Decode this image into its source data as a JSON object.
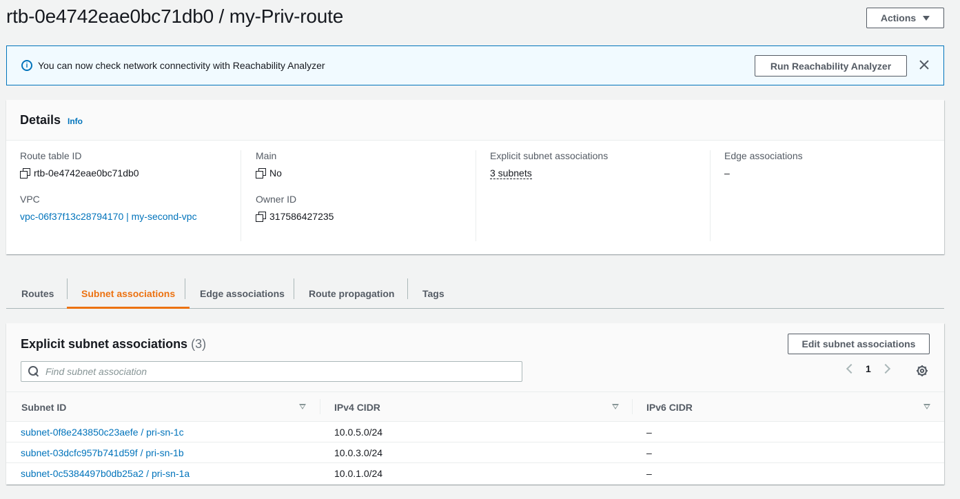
{
  "page": {
    "title": "rtb-0e4742eae0bc71db0 / my-Priv-route",
    "actions_label": "Actions"
  },
  "flash": {
    "message": "You can now check network connectivity with Reachability Analyzer",
    "button_label": "Run Reachability Analyzer"
  },
  "details": {
    "title": "Details",
    "info": "Info",
    "route_table_id_label": "Route table ID",
    "route_table_id": "rtb-0e4742eae0bc71db0",
    "vpc_label": "VPC",
    "vpc": "vpc-06f37f13c28794170 | my-second-vpc",
    "main_label": "Main",
    "main": "No",
    "owner_label": "Owner ID",
    "owner": "317586427235",
    "explicit_label": "Explicit subnet associations",
    "explicit": "3 subnets",
    "edge_label": "Edge associations",
    "edge": "–"
  },
  "tabs": [
    {
      "label": "Routes"
    },
    {
      "label": "Subnet associations",
      "active": true
    },
    {
      "label": "Edge associations"
    },
    {
      "label": "Route propagation"
    },
    {
      "label": "Tags"
    }
  ],
  "subnets": {
    "title": "Explicit subnet associations",
    "count": "(3)",
    "edit_label": "Edit subnet associations",
    "search_placeholder": "Find subnet association",
    "page": "1",
    "columns": [
      "Subnet ID",
      "IPv4 CIDR",
      "IPv6 CIDR"
    ],
    "rows": [
      {
        "subnet": "subnet-0f8e243850c23aefe / pri-sn-1c",
        "ipv4": "10.0.5.0/24",
        "ipv6": "–"
      },
      {
        "subnet": "subnet-03dcfc957b741d59f / pri-sn-1b",
        "ipv4": "10.0.3.0/24",
        "ipv6": "–"
      },
      {
        "subnet": "subnet-0c5384497b0db25a2 / pri-sn-1a",
        "ipv4": "10.0.1.0/24",
        "ipv6": "–"
      }
    ]
  },
  "colors": {
    "accent": "#ec7211",
    "link": "#0073bb",
    "info_bg": "#f1faff"
  },
  "icons": [
    "info-icon",
    "close-icon",
    "copy-icon",
    "caret-down-icon",
    "search-icon",
    "chevron-left-icon",
    "chevron-right-icon",
    "gear-icon",
    "sort-icon"
  ]
}
